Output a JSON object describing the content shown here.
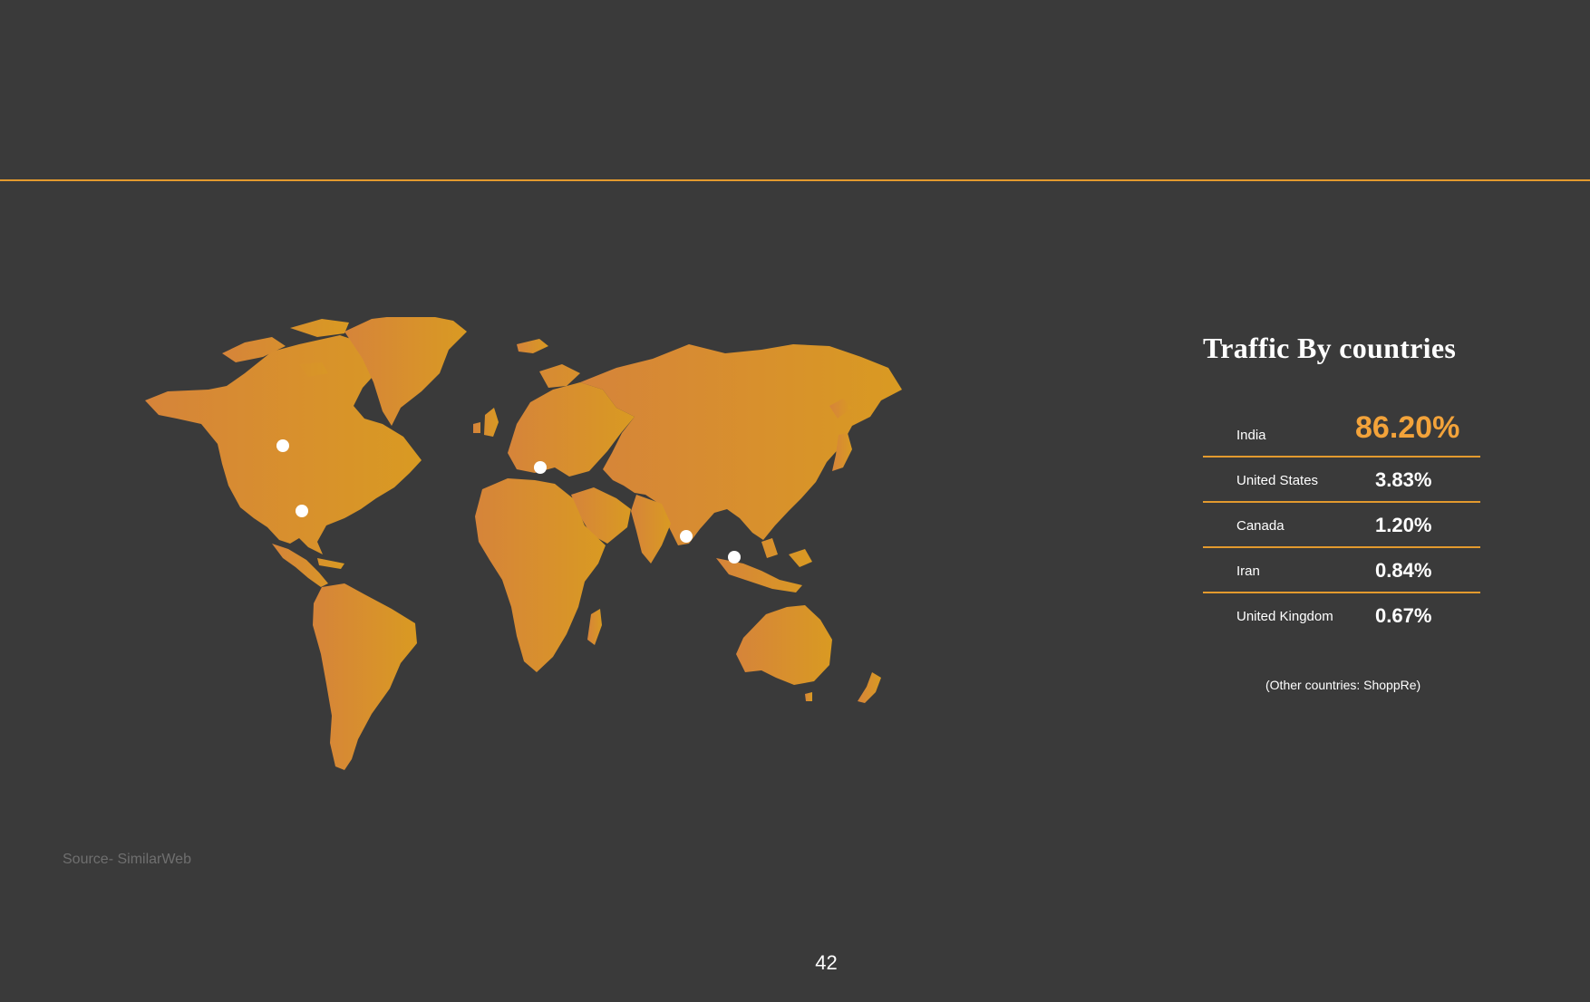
{
  "panel": {
    "title": "Traffic By countries",
    "rows": [
      {
        "country": "India",
        "share": "86.20%"
      },
      {
        "country": "United States",
        "share": "3.83%"
      },
      {
        "country": "Canada",
        "share": "1.20%"
      },
      {
        "country": "Iran",
        "share": "0.84%"
      },
      {
        "country": "United Kingdom",
        "share": "0.67%"
      }
    ],
    "other_note": "(Other countries: ShoppRe)"
  },
  "source": "Source- SimilarWeb",
  "page_number": "42",
  "colors": {
    "background": "#3a3a3a",
    "accent": "#e39a2e",
    "highlight": "#f3a33a",
    "land": "#d88c2f",
    "marker": "#ffffff"
  },
  "map": {
    "markers": [
      "Canada",
      "United States",
      "United Kingdom",
      "Iran",
      "India"
    ]
  }
}
